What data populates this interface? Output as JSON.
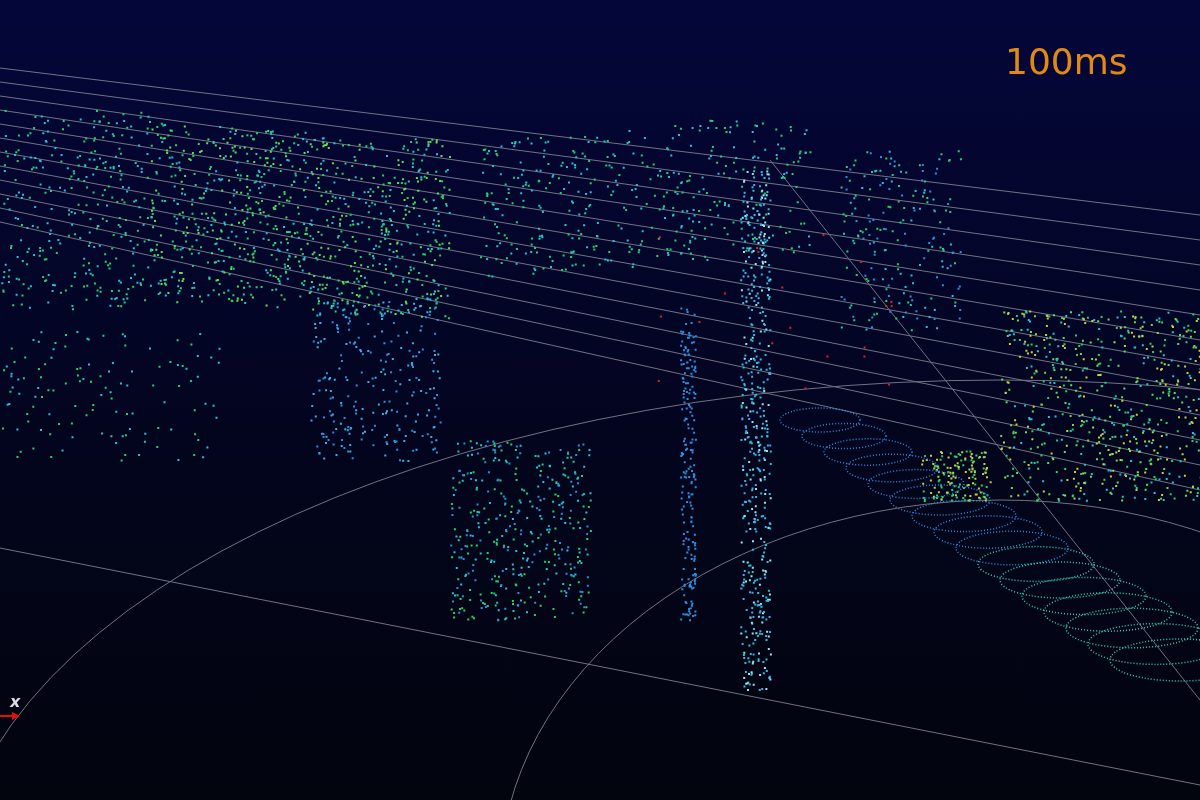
{
  "overlay": {
    "time_label": "100ms"
  },
  "axes": {
    "x_label": "x"
  }
}
